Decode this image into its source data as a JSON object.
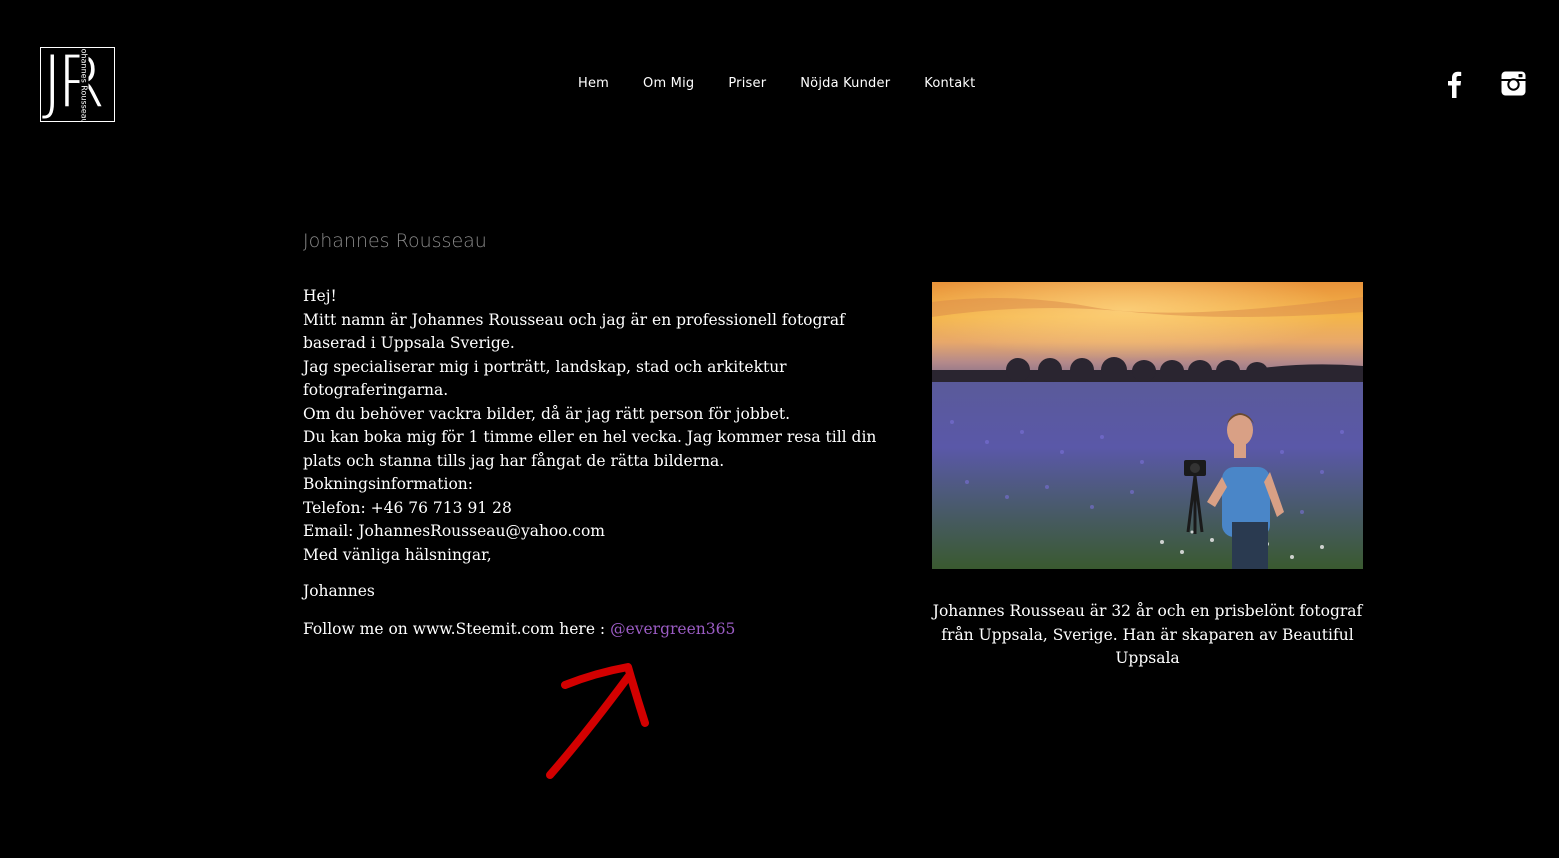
{
  "logo": {
    "letters": "JR",
    "vertical_text": "Johannes Rousseau"
  },
  "nav": {
    "items": [
      "Hem",
      "Om Mig",
      "Priser",
      "Nöjda Kunder",
      "Kontakt"
    ]
  },
  "social": {
    "icons": [
      "facebook-icon",
      "instagram-icon"
    ]
  },
  "main": {
    "title": "Johannes Rousseau",
    "lines": [
      "Hej!",
      "Mitt namn är Johannes Rousseau och jag är en professionell fotograf baserad i Uppsala Sverige.",
      "Jag specialiserar mig i porträtt, landskap, stad och arkitektur fotograferingarna.",
      "Om du behöver vackra bilder, då är jag rätt person för jobbet.",
      "Du kan boka mig för 1 timme eller en hel vecka. Jag kommer resa till din plats och stanna tills jag har fångat de rätta bilderna.",
      "Bokningsinformation:",
      "Telefon: +46 76 713 91 28",
      "Email: JohannesRousseau@yahoo.com",
      "Med vänliga hälsningar,"
    ],
    "signature": "Johannes",
    "follow_text": "Follow me on www.Steemit.com here : ",
    "follow_link": "@evergreen365"
  },
  "photo": {
    "caption": "Johannes Rousseau är 32 år och en prisbelönt fotograf från Uppsala, Sverige. Han är skaparen av Beautiful Uppsala"
  },
  "colors": {
    "background": "#000000",
    "title": "#8a8a8a",
    "link": "#9b5cc4",
    "arrow": "#d30000"
  }
}
